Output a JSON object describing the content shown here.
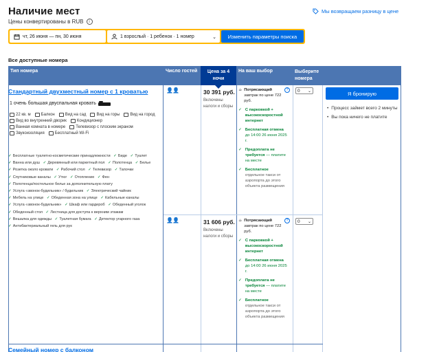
{
  "header": {
    "title": "Наличие мест",
    "subtitle": "Цены конвертированы в RUB",
    "price_match": "Мы возвращаем разницу в цене"
  },
  "search": {
    "dates": "чт, 26 июня — пн, 30 июня",
    "guests": "1 взрослый · 1 ребенок · 1 номер",
    "button": "Изменить параметры поиска"
  },
  "section_title": "Все доступные номера",
  "table": {
    "headers": {
      "room_type": "Тип номера",
      "guests": "Число гостей",
      "price": "Цена за 4 ночи",
      "choice": "На ваш выбор",
      "select": "Выберите номера"
    }
  },
  "room1": {
    "name": "Стандартный двухместный номер с 1 кроватью",
    "bed": "1 очень большая двуспальная кровать",
    "features": [
      "22 кв. м",
      "Балкон",
      "Вид на сад",
      "Вид на горы",
      "Вид на город",
      "Вид во внутренний дворик",
      "Кондиционер",
      "Ванная комната в номере",
      "Телевизор с плоским экраном",
      "Звукоизоляция",
      "Бесплатный Wi-Fi"
    ],
    "amenities": [
      "Бесплатные туалетно-косметические принадлежности",
      "Биде",
      "Туалет",
      "Ванна или душ",
      "Деревянный или паркетный пол",
      "Полотенца",
      "Белье",
      "Розетка около кровати",
      "Рабочий стол",
      "Телевизор",
      "Тапочки",
      "Спутниковые каналы",
      "Утюг",
      "Отопление",
      "Фен",
      "Полотенца/постельное белье за дополнительную плату",
      "Услуга «звонок-будильник» / будильник",
      "Электрический чайник",
      "Мебель на улице",
      "Обеденная зона на улице",
      "Кабельные каналы",
      "Услуга «звонок-будильник»",
      "Шкаф или гардероб",
      "Обеденный уголок",
      "Обеденный стол",
      "Лестница для доступа к верхним этажам",
      "Вешалка для одежды",
      "Туалетная бумага",
      "Детектор угарного газа",
      "Антибактериальный гель для рук"
    ]
  },
  "option1": {
    "price": "30 391 руб.",
    "price_note": "Включены налоги и сборы",
    "breakfast_title": "Потрясающий",
    "breakfast_rest": "завтрак по цене 722 руб.",
    "parking": "С парковкой + высокоскоростной интернет",
    "cancel_title": "Бесплатная отмена",
    "cancel_rest": "до 14:00 26 июня 2025 г.",
    "prepay_title": "Предоплата не требуется",
    "prepay_rest": "— платите на месте",
    "taxi_title": "Бесплатное",
    "taxi_rest": "отдельное такси от аэропорта до этого объекта размещения",
    "select": "0"
  },
  "option2": {
    "price": "31 606 руб.",
    "price_note": "Включены налоги и сборы",
    "breakfast_title": "Потрясающий",
    "breakfast_rest": "завтрак по цене 722 руб.",
    "parking": "С парковкой + высокоскоростной интернет",
    "cancel_title": "Бесплатная отмена",
    "cancel_rest": "до 14:00 26 июня 2025 г.",
    "prepay_title": "Предоплата не требуется",
    "prepay_rest": "— платите на месте",
    "taxi_title": "Бесплатное",
    "taxi_rest": "отдельное такси от аэропорта до этого объекта размещения",
    "select": "0"
  },
  "booking": {
    "button": "Я бронирую",
    "notes": [
      "Процесс займет всего 2 минуты",
      "Вы пока ничего не платите"
    ]
  },
  "room2_name": "Семейный номер с балконом",
  "icons": {
    "info": "info-icon",
    "tag": "price-tag-icon",
    "calendar": "calendar-icon",
    "person": "person-icon",
    "guests": "guests-icon",
    "bed": "bed-icon"
  },
  "colors": {
    "brand_blue": "#006ce4",
    "header_blue": "#4c76b2",
    "highlight_blue": "#003b95",
    "search_yellow": "#ffb700",
    "green": "#008234"
  }
}
